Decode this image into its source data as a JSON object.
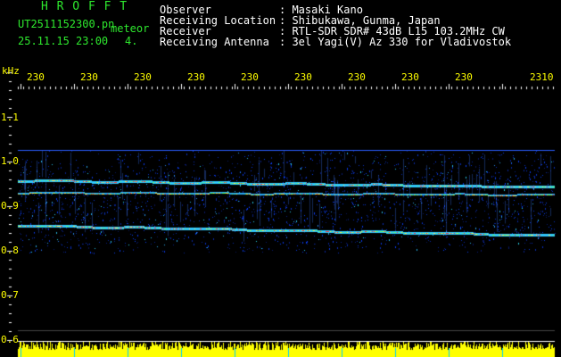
{
  "header": {
    "logo": "H R O F F T",
    "filename": "UT2511152300.pn",
    "file_type": "meteor",
    "date_time": "25.11.15 23:00",
    "frame": "4.",
    "fields": [
      {
        "label": "Observer",
        "value": ": Masaki Kano"
      },
      {
        "label": "Receiving Location",
        "value": ": Shibukawa, Gunma, Japan"
      },
      {
        "label": "Receiver",
        "value": ": RTL-SDR SDR# 43dB L15 103.2MHz CW"
      },
      {
        "label": "Receiving Antenna",
        "value": ": 3el Yagi(V) Az 330 for Vladivostok"
      }
    ]
  },
  "chart_data": {
    "type": "heatmap",
    "ylabel": "kHz",
    "ylim": [
      0.6,
      1.2
    ],
    "yticks": [
      "1.1",
      "1.0",
      "0.9",
      "0.8",
      "0.7",
      "0.6"
    ],
    "xticks": [
      "230",
      "230",
      "230",
      "230",
      "230",
      "230",
      "230",
      "230",
      "230",
      "2310"
    ],
    "signal_lines_khz": [
      {
        "start": 0.958,
        "end": 0.943,
        "strength": "strong"
      },
      {
        "start": 0.93,
        "end": 0.925,
        "strength": "medium"
      },
      {
        "start": 0.857,
        "end": 0.835,
        "strength": "strong"
      }
    ],
    "band_khz": [
      0.795,
      1.025
    ],
    "colors": {
      "background": "#000000",
      "noise": "#1a3cc8",
      "signal": "#40e0ff",
      "peak": "#ff3030",
      "level_bar": "#ffff00",
      "ticks": "#ffffff",
      "text": "#2ee82e"
    }
  }
}
